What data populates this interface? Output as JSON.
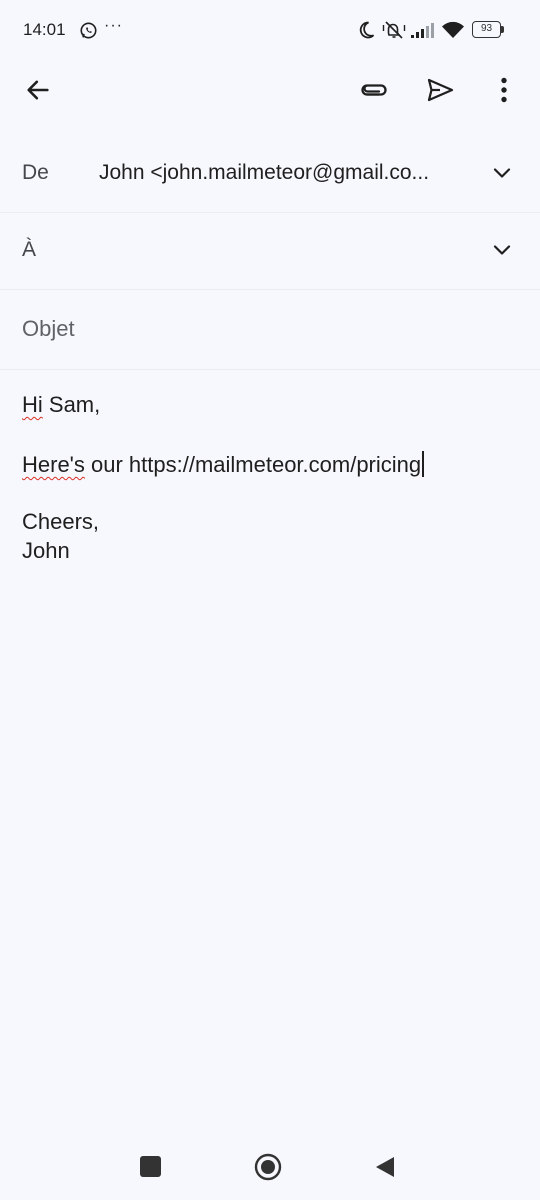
{
  "status_bar": {
    "time": "14:01",
    "overflow": "···",
    "battery": "93",
    "icons": [
      "whatsapp-icon",
      "moon-icon",
      "mute-icon",
      "signal-icon",
      "wifi-icon",
      "battery-icon"
    ]
  },
  "app_bar": {
    "icons": [
      "back-arrow-icon",
      "attach-icon",
      "send-icon",
      "more-vert-icon"
    ]
  },
  "compose": {
    "from_label": "De",
    "from_value": "John  <john.mailmeteor@gmail.co...",
    "to_label": "À",
    "subject_placeholder": "Objet",
    "body": {
      "greeting_word": "Hi",
      "greeting_rest": " Sam,",
      "line2_word": "Here's",
      "line2_rest": " our https://mailmeteor.com/pricing",
      "closing": "Cheers,",
      "signature": "John"
    }
  },
  "nav_bar": {
    "icons": [
      "recents-icon",
      "home-icon",
      "back-icon"
    ]
  },
  "colors": {
    "background": "#f7f8fd",
    "text": "#1f1f1f",
    "spellcheck": "#d93025"
  }
}
